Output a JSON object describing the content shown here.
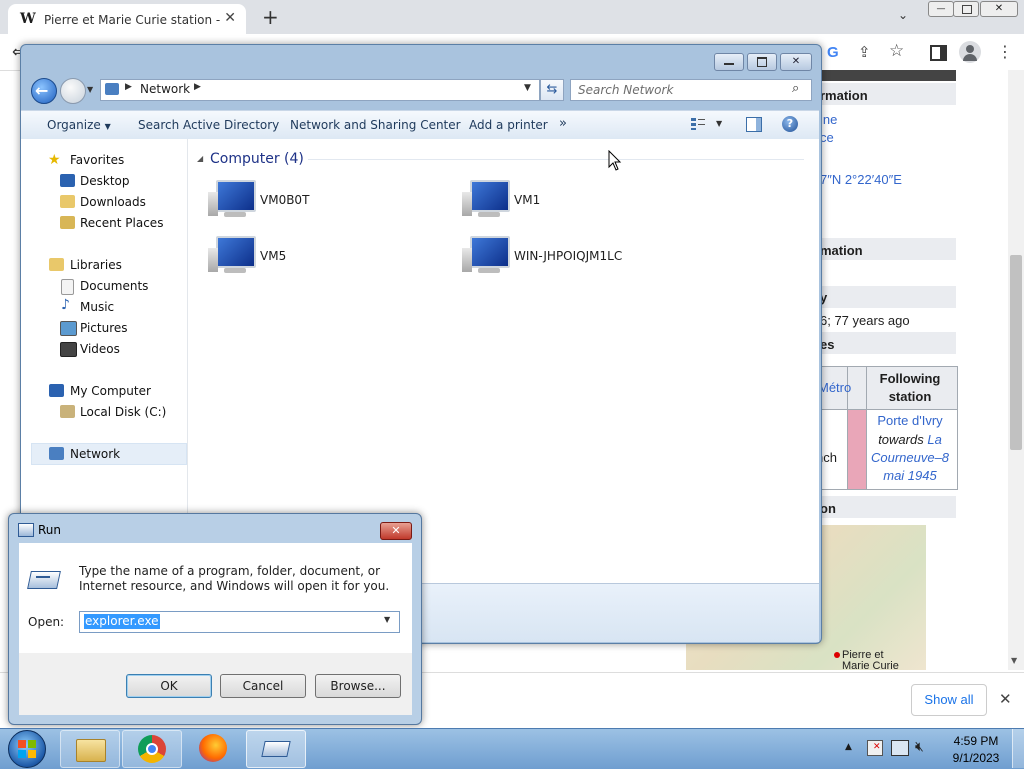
{
  "browser": {
    "tab_title": "Pierre et Marie Curie station - W",
    "tab_favicon": "W",
    "new_tab": "+",
    "tab_close": "✕",
    "window_min": "—",
    "window_close": "✕"
  },
  "wiki": {
    "h1": "rmation",
    "link1": "ine",
    "link2": "ce",
    "coords": "7″N 2°22′40″E",
    "h2": "mation",
    "h3": "y",
    "opened": "6; 77 years ago",
    "h4": "es",
    "metro": "Métro",
    "following_header": "Following station",
    "porte": "Porte d'Ivry",
    "towards": "towards",
    "dest": "La Courneuve–8 mai 1945",
    "nch": "nch",
    "h5": "on",
    "map_label": "Pierre et Marie Curie"
  },
  "download_bar": {
    "show_all": "Show all",
    "close": "✕"
  },
  "explorer": {
    "address_location": "Network",
    "search_placeholder": "Search Network",
    "toolbar": {
      "organize": "Organize",
      "search_ad": "Search Active Directory",
      "network_sharing": "Network and Sharing Center",
      "add_printer": "Add a printer",
      "more": "»"
    },
    "nav": {
      "favorites": "Favorites",
      "desktop": "Desktop",
      "downloads": "Downloads",
      "recent": "Recent Places",
      "libraries": "Libraries",
      "documents": "Documents",
      "music": "Music",
      "pictures": "Pictures",
      "videos": "Videos",
      "my_computer": "My Computer",
      "local_disk": "Local Disk (C:)",
      "network": "Network"
    },
    "group_header": "Computer (4)",
    "computers": [
      "VM0B0T",
      "VM1",
      "VM5",
      "WIN-JHPOIQJM1LC"
    ]
  },
  "run": {
    "title": "Run",
    "description": "Type the name of a program, folder, document, or Internet resource, and Windows will open it for you.",
    "open_label": "Open:",
    "value": "explorer.exe",
    "ok": "OK",
    "cancel": "Cancel",
    "browse": "Browse..."
  },
  "taskbar": {
    "time": "4:59 PM",
    "date": "9/1/2023"
  },
  "colors": {
    "selection": "#3399ff",
    "explorer_frame": "#a9c3de",
    "link": "#3366cc"
  }
}
